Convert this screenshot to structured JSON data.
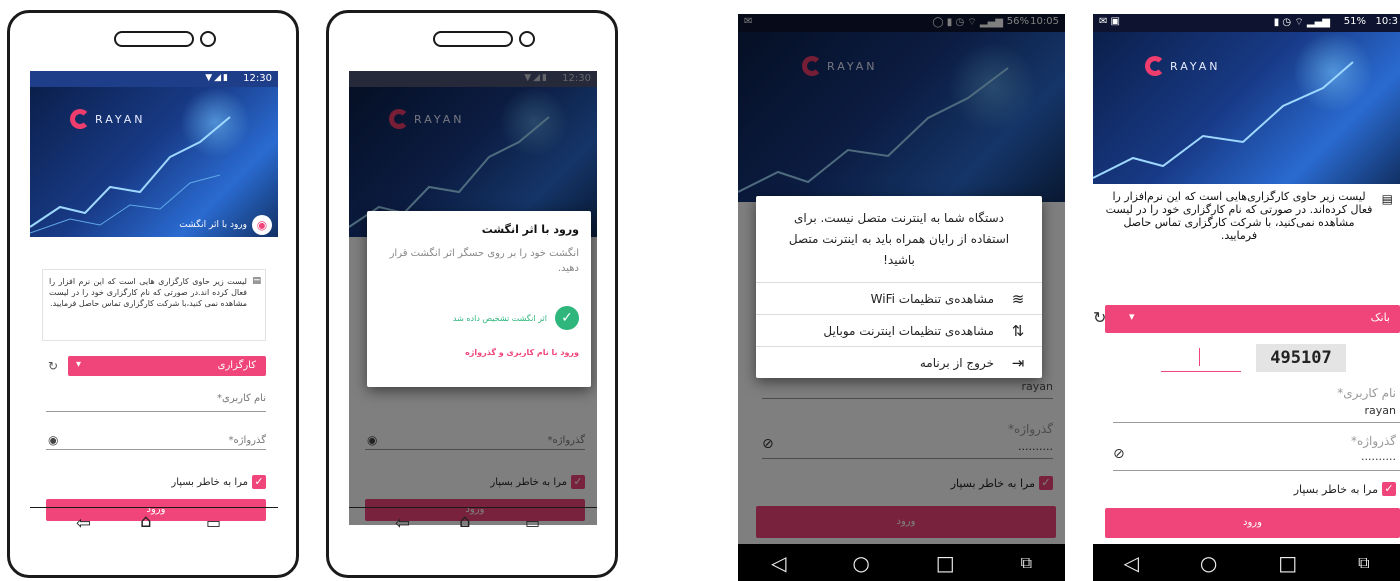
{
  "brand": {
    "logo_text": "RAYAN"
  },
  "mock1": {
    "status_time": "12:30",
    "fingerprint_badge": "ورود با اثر انگشت",
    "info_text": "لیست زیر حاوی کارگزاری هایی است که این نرم افزار را فعال کرده اند.در صورتی که نام کارگزاری خود را در لیست مشاهده نمی کنید،با شرکت کارگزاری تماس حاصل فرمایید.",
    "broker_select": "کارگزاری",
    "username_label": "نام کاربری*",
    "password_label": "گذرواژه*",
    "remember_label": "مرا به خاطر بسپار",
    "login_button": "ورود"
  },
  "mock2": {
    "status_time": "12:30",
    "dialog_title": "ورود با اثر انگشت",
    "dialog_body": "انگشت خود را بر روی حسگر اثر انگشت قرار دهید.",
    "success_text": "اثر انگشت تشخیص داده شد",
    "alt_link": "ورود با نام کاربری و گذرواژه",
    "password_label": "گذرواژه*",
    "remember_label": "مرا به خاطر بسپار",
    "login_button": "ورود"
  },
  "shot3": {
    "status_battery": "56%",
    "status_time": "10:05",
    "dialog_message": "دستگاه شما به اینترنت متصل نیست. برای استفاده از رایان همراه باید به اینترنت متصل باشید!",
    "menu": [
      {
        "label": "مشاهده‌ی تنظیمات WiFi",
        "icon": "wifi-icon"
      },
      {
        "label": "مشاهده‌ی تنظیمات اینترنت موبایل",
        "icon": "mobile-data-icon"
      },
      {
        "label": "خروج از برنامه",
        "icon": "exit-icon"
      }
    ],
    "username_value": "rayan",
    "password_label": "گذرواژه*",
    "password_value": "..........",
    "remember_label": "مرا به خاطر بسپار",
    "login_button": "ورود"
  },
  "shot4": {
    "status_battery": "51%",
    "status_time": "10:3",
    "info_text": "لیست زیر حاوی کارگزاری‌هایی است که این نرم‌افزار را فعال کرده‌اند. در صورتی که نام کارگزاری خود را در لیست مشاهده نمی‌کنید، با شرکت کارگزاری تماس حاصل فرمایید.",
    "broker_select": "بانک",
    "captcha_value": "495107",
    "username_label": "نام کاربری*",
    "username_value": "rayan",
    "password_label": "گذرواژه*",
    "password_value": "..........",
    "remember_label": "مرا به خاطر بسپار",
    "login_button": "ورود"
  }
}
